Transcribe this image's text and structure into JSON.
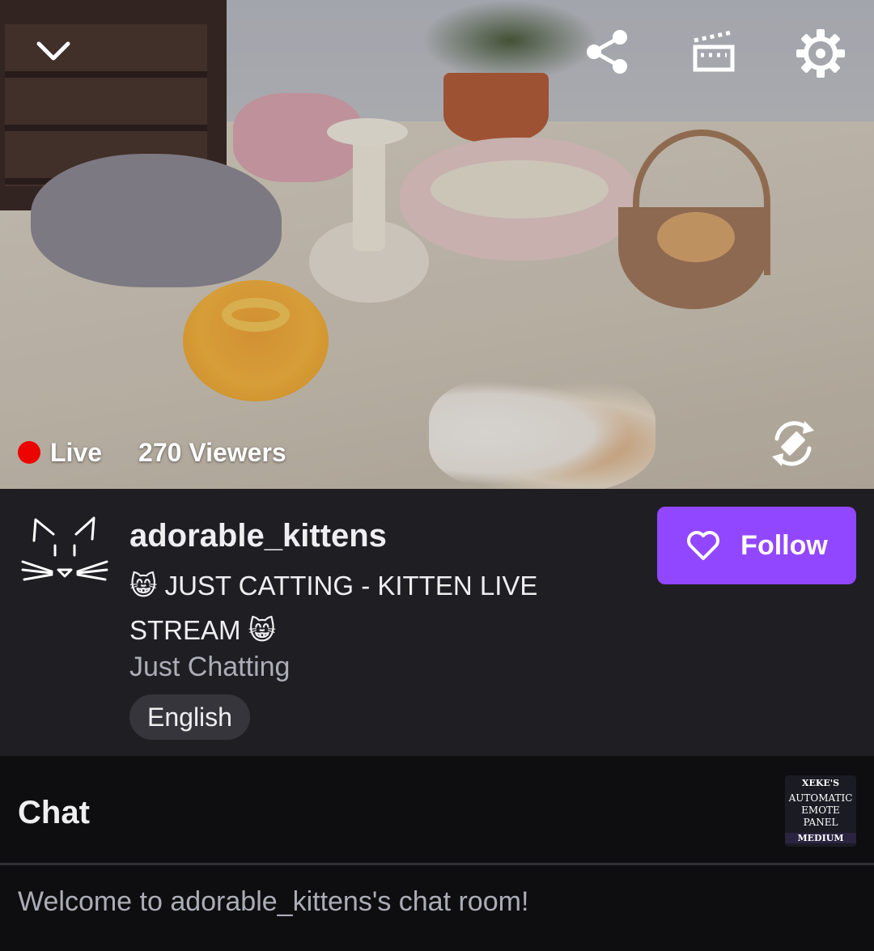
{
  "player": {
    "live_label": "Live",
    "viewers_label": "270 Viewers",
    "icons": [
      "chevron-down-icon",
      "share-icon",
      "clip-icon",
      "settings-icon",
      "rotate-screen-icon"
    ]
  },
  "channel": {
    "name": "adorable_kittens",
    "title": "😸 JUST CATTING - KITTEN LIVE STREAM 😸",
    "category": "Just Chatting",
    "language_tag": "English",
    "follow_label": "Follow"
  },
  "chat": {
    "header": "Chat",
    "welcome_message": "Welcome to adorable_kittens's chat room!",
    "extension_panel": {
      "line1": "XEKE'S",
      "line2": "AUTOMATIC",
      "line3": "EMOTE",
      "line4": "PANEL",
      "line5": "MEDIUM"
    }
  },
  "colors": {
    "accent": "#9147ff",
    "live": "#eb0400",
    "background": "#18181b",
    "info_background": "#1f1f23",
    "chat_background": "#0e0e10"
  }
}
